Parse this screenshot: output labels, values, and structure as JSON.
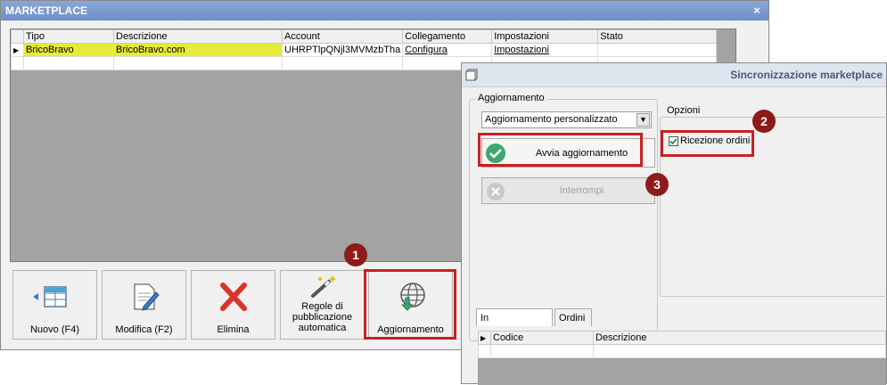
{
  "marketplace": {
    "title": "MARKETPLACE",
    "close_glyph": "×",
    "columns": [
      "Tipo",
      "Descrizione",
      "Account",
      "Collegamento",
      "Impostazioni",
      "Stato"
    ],
    "row": {
      "marker": "▶",
      "tipo": "BricoBravo",
      "descrizione": "BricoBravo.com",
      "account": "UHRPTlpQNjl3MVMzbTha",
      "collegamento": "Configura",
      "impostazioni": "Impostazioni",
      "stato": ""
    },
    "toolbar": [
      {
        "label": "Nuovo (F4)",
        "icon": "new-record-icon"
      },
      {
        "label": "Modifica (F2)",
        "icon": "edit-document-icon"
      },
      {
        "label": "Elimina",
        "icon": "delete-x-icon"
      },
      {
        "label": "Regole di pubblicazione automatica",
        "icon": "magic-wand-icon"
      },
      {
        "label": "Aggiornamento",
        "icon": "globe-download-icon"
      }
    ]
  },
  "sync": {
    "title": "Sincronizzazione marketplace",
    "group_update_label": "Aggiornamento",
    "dropdown_value": "Aggiornamento personalizzato",
    "start_button": "Avvia aggiornamento",
    "stop_button": "Interrompi",
    "group_options_label": "Opzioni",
    "checkbox_label": "Ricezione ordini",
    "checkbox_checked": true,
    "tabs": [
      "In pubblicazione",
      "Ordini"
    ],
    "bottom_columns": [
      "Codice",
      "Descrizione"
    ],
    "bottom_marker": "▶"
  },
  "badges": [
    "1",
    "2",
    "3"
  ],
  "colors": {
    "highlight_red": "#c82020",
    "badge": "#8e1a1a",
    "selected_row": "#e6ea3a",
    "success_green": "#3ca870"
  }
}
